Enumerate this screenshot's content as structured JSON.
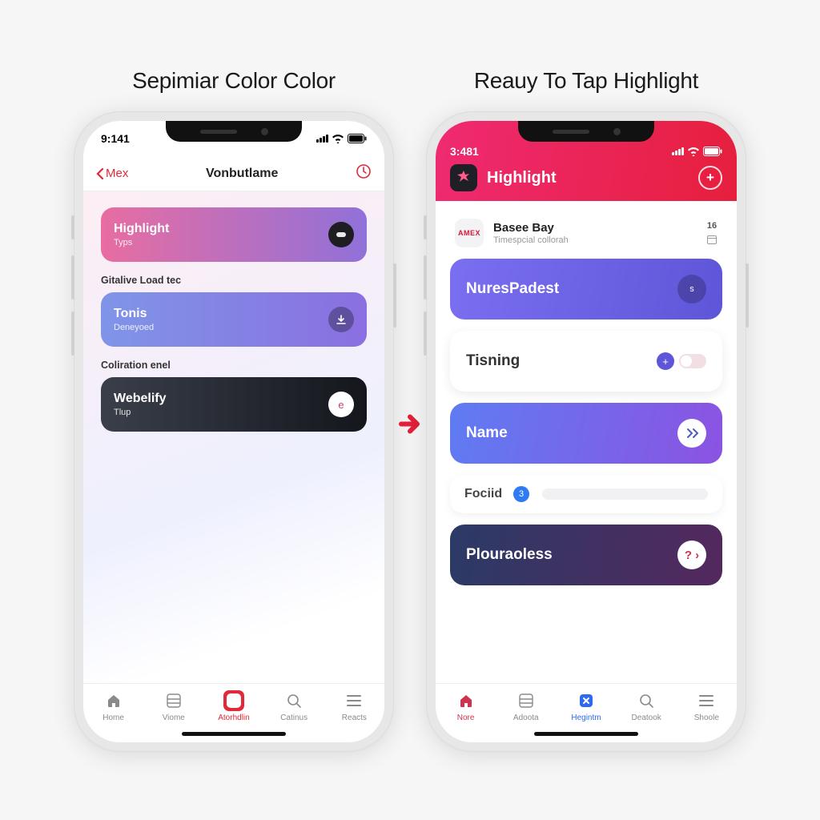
{
  "left": {
    "title": "Sepimiar Color Color",
    "status_time": "9:141",
    "nav_back": "Mex",
    "nav_title": "Vonbutlame",
    "cards": [
      {
        "title": "Highlight",
        "sub": "Typs"
      },
      {
        "title": "Tonis",
        "sub": "Deneyoed"
      },
      {
        "title": "Webelify",
        "sub": "Tlup"
      }
    ],
    "section_labels": [
      "Gitalive Load tec",
      "Coliration enel"
    ],
    "tabs": [
      {
        "label": "Home"
      },
      {
        "label": "Viome"
      },
      {
        "label": "Atorhdlin"
      },
      {
        "label": "Catinus"
      },
      {
        "label": "Reacts"
      }
    ]
  },
  "right": {
    "title": "Reauy To Tap Highlight",
    "status_time": "3:481",
    "header_title": "Highlight",
    "row": {
      "avatar_text": "AMEX",
      "title": "Basee Bay",
      "sub": "Timespcial collorah",
      "meta": "16"
    },
    "cards": {
      "nures": "NuresPadest",
      "tisning": "Tisning",
      "name": "Name",
      "fociid": "Fociid",
      "fociid_badge": "3",
      "plour": "Plouraoless"
    },
    "tabs": [
      {
        "label": "Nore"
      },
      {
        "label": "Adoota"
      },
      {
        "label": "Hegintm"
      },
      {
        "label": "Deatook"
      },
      {
        "label": "Shoole"
      }
    ]
  }
}
